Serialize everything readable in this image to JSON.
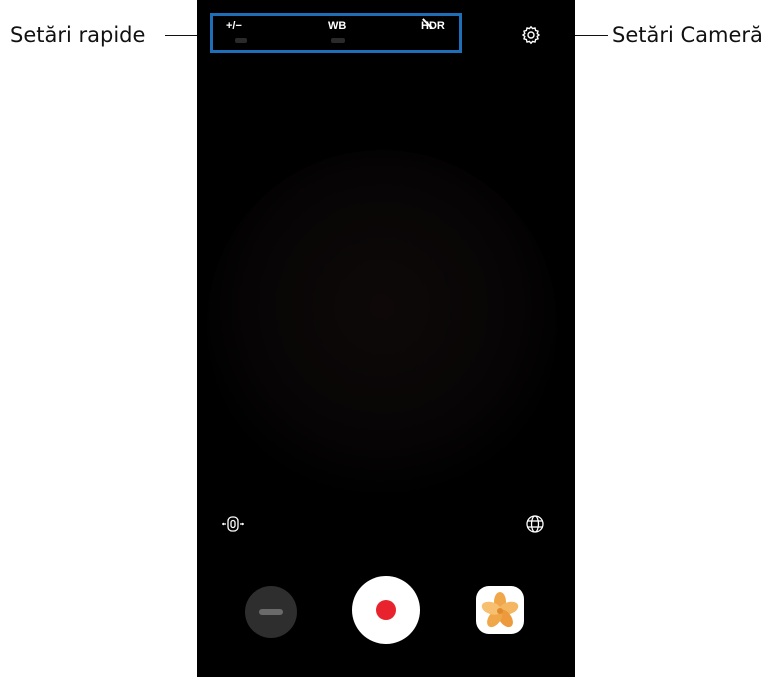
{
  "callouts": {
    "quick_settings": "Setări rapide",
    "camera_settings": "Setări Cameră"
  },
  "quick_settings": {
    "exposure_label": "+/−",
    "white_balance_label": "WB",
    "hdr_label": "HDR"
  },
  "icons": {
    "settings": "gear-icon",
    "lens_switch": "rotate-lens-icon",
    "view_mode": "globe-icon",
    "mode": "mode-blur-icon",
    "record": "record-dot-icon",
    "gallery": "flower-gallery-icon"
  },
  "colors": {
    "highlight": "#1f6fb8",
    "record": "#e8232d",
    "gallery_petal": "#f0a74a"
  }
}
